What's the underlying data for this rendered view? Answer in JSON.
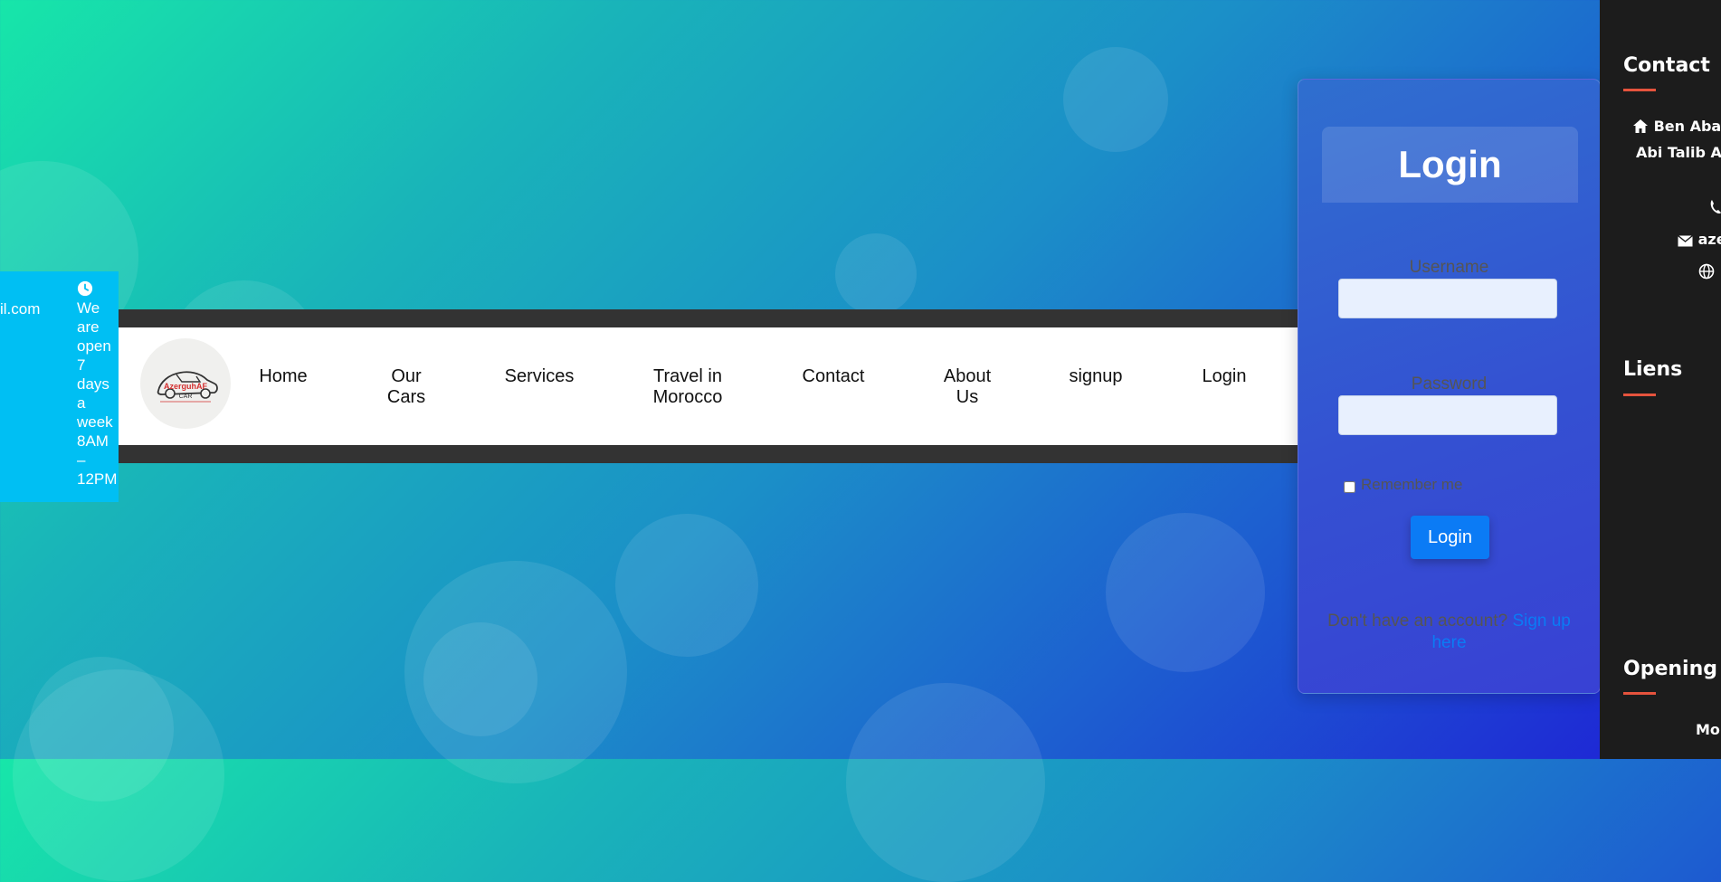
{
  "info_strip": {
    "email_fragment": "il.com",
    "hours_text": "We are open 7 days a week 8AM – 12PM",
    "clock_icon": "clock-icon"
  },
  "navbar": {
    "logo_alt": "Azerguh car logo",
    "logo_text": "AzerguhAF",
    "logo_subtext": "CAR",
    "items": [
      {
        "label": "Home"
      },
      {
        "label": "Our Cars"
      },
      {
        "label": "Services"
      },
      {
        "label": "Travel in Morocco"
      },
      {
        "label": "Contact"
      },
      {
        "label": "About Us"
      },
      {
        "label": "signup"
      },
      {
        "label": "Login"
      }
    ]
  },
  "login": {
    "title": "Login",
    "username_label": "Username",
    "username_value": "",
    "password_label": "Password",
    "password_value": "",
    "remember_label": "Remember me",
    "remember_checked": false,
    "button_label": "Login",
    "signup_prompt": "Don't have an account? ",
    "signup_link": "Sign up here"
  },
  "footer": {
    "contact_heading": "Contact",
    "address_line1": "Ben Aba",
    "address_line2": "Abi Talib A",
    "email_fragment": "aze",
    "liens_heading": "Liens",
    "opening_heading": "Opening T",
    "opening_day_fragment": "Mo"
  },
  "colors": {
    "accent_blue": "#0b7bf5",
    "info_strip": "#00bff3",
    "footer_bg": "#1c1c1c",
    "footer_underline": "#e5533d"
  }
}
